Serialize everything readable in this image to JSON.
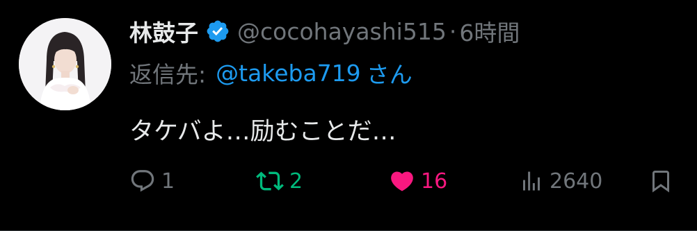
{
  "tweet": {
    "display_name": "林鼓子",
    "handle": "@cocohayashi515",
    "separator": "·",
    "time": "6時間",
    "reply_label": "返信先:",
    "reply_user": "@takeba719",
    "reply_suffix": "さん",
    "text": "タケバよ…励むことだ…"
  },
  "actions": {
    "replies": "1",
    "retweets": "2",
    "likes": "16",
    "views": "2640"
  },
  "icons": {
    "verified": "verified-badge-icon",
    "reply": "reply-icon",
    "retweet": "retweet-icon",
    "like": "heart-icon",
    "views": "views-icon",
    "bookmark": "bookmark-icon"
  },
  "colors": {
    "background": "#000000",
    "text": "#e7e9ea",
    "muted": "#71767b",
    "link": "#1d9bf0",
    "retweet": "#00ba7c",
    "like": "#f91880"
  }
}
